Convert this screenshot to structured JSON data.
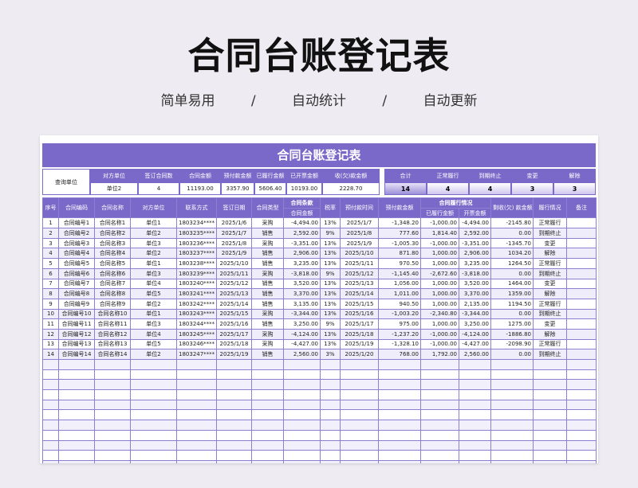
{
  "hero": {
    "title": "合同台账登记表",
    "tags": [
      "简单易用",
      "/",
      "自动统计",
      "/",
      "自动更新"
    ]
  },
  "sheet_title": "合同台账登记表",
  "summary": {
    "query_label": "查询单位",
    "headers": [
      "对方单位",
      "签订合同数",
      "合同金额",
      "预付款金额",
      "已履行金额",
      "已开票金额",
      "收(欠)款金额"
    ],
    "values": [
      "单位2",
      "4",
      "11193.00",
      "3357.90",
      "5606.40",
      "10193.00",
      "2228.70"
    ],
    "count_headers": [
      "合计",
      "正常履行",
      "到期终止",
      "变更",
      "解除"
    ],
    "counts": [
      "14",
      "4",
      "4",
      "3",
      "3"
    ]
  },
  "table": {
    "headers": {
      "seq": "序号",
      "code": "合同编码",
      "name": "合同名称",
      "party": "对方单位",
      "contact": "联系方式",
      "date": "签订日期",
      "type": "合同类型",
      "amount_top": "合同条款",
      "amount_bottom": "合同金额",
      "tax": "税率",
      "pre_time": "预付款时间",
      "pre_amt": "预付款金额",
      "perf_top": "合同履行情况",
      "perf_done": "已履行金额",
      "perf_inv": "开票金额",
      "recv": "剩收(欠) 款金额",
      "status": "履行情况",
      "remark": "备注"
    },
    "rows": [
      [
        "1",
        "合同编号1",
        "合同名称1",
        "单位1",
        "1803234****",
        "2025/1/6",
        "采购",
        "-4,494.00",
        "13%",
        "2025/1/7",
        "-1,348.20",
        "-1,000.00",
        "-4,494.00",
        "-2145.80",
        "正常履行",
        ""
      ],
      [
        "2",
        "合同编号2",
        "合同名称2",
        "单位2",
        "1803235****",
        "2025/1/7",
        "销售",
        "2,592.00",
        "9%",
        "2025/1/8",
        "777.60",
        "1,814.40",
        "2,592.00",
        "0.00",
        "到期终止",
        ""
      ],
      [
        "3",
        "合同编号3",
        "合同名称3",
        "单位3",
        "1803236****",
        "2025/1/8",
        "采购",
        "-3,351.00",
        "13%",
        "2025/1/9",
        "-1,005.30",
        "-1,000.00",
        "-3,351.00",
        "-1345.70",
        "变更",
        ""
      ],
      [
        "4",
        "合同编号4",
        "合同名称4",
        "单位2",
        "1803237****",
        "2025/1/9",
        "销售",
        "2,906.00",
        "13%",
        "2025/1/10",
        "871.80",
        "1,000.00",
        "2,906.00",
        "1034.20",
        "解除",
        ""
      ],
      [
        "5",
        "合同编号5",
        "合同名称5",
        "单位1",
        "1803238****",
        "2025/1/10",
        "销售",
        "3,235.00",
        "13%",
        "2025/1/11",
        "970.50",
        "1,000.00",
        "3,235.00",
        "1264.50",
        "正常履行",
        ""
      ],
      [
        "6",
        "合同编号6",
        "合同名称6",
        "单位3",
        "1803239****",
        "2025/1/11",
        "采购",
        "-3,818.00",
        "9%",
        "2025/1/12",
        "-1,145.40",
        "-2,672.60",
        "-3,818.00",
        "0.00",
        "到期终止",
        ""
      ],
      [
        "7",
        "合同编号7",
        "合同名称7",
        "单位4",
        "1803240****",
        "2025/1/12",
        "销售",
        "3,520.00",
        "13%",
        "2025/1/13",
        "1,056.00",
        "1,000.00",
        "3,520.00",
        "1464.00",
        "变更",
        ""
      ],
      [
        "8",
        "合同编号8",
        "合同名称8",
        "单位5",
        "1803241****",
        "2025/1/13",
        "销售",
        "3,370.00",
        "13%",
        "2025/1/14",
        "1,011.00",
        "1,000.00",
        "3,370.00",
        "1359.00",
        "解除",
        ""
      ],
      [
        "9",
        "合同编号9",
        "合同名称9",
        "单位2",
        "1803242****",
        "2025/1/14",
        "销售",
        "3,135.00",
        "13%",
        "2025/1/15",
        "940.50",
        "1,000.00",
        "2,135.00",
        "1194.50",
        "正常履行",
        ""
      ],
      [
        "10",
        "合同编号10",
        "合同名称10",
        "单位1",
        "1803243****",
        "2025/1/15",
        "采购",
        "-3,344.00",
        "13%",
        "2025/1/16",
        "-1,003.20",
        "-2,340.80",
        "-3,344.00",
        "0.00",
        "到期终止",
        ""
      ],
      [
        "11",
        "合同编号11",
        "合同名称11",
        "单位3",
        "1803244****",
        "2025/1/16",
        "销售",
        "3,250.00",
        "9%",
        "2025/1/17",
        "975.00",
        "1,000.00",
        "3,250.00",
        "1275.00",
        "变更",
        ""
      ],
      [
        "12",
        "合同编号12",
        "合同名称12",
        "单位4",
        "1803245****",
        "2025/1/17",
        "采购",
        "-4,124.00",
        "13%",
        "2025/1/18",
        "-1,237.20",
        "-1,000.00",
        "-4,124.00",
        "-1886.80",
        "解除",
        ""
      ],
      [
        "13",
        "合同编号13",
        "合同名称13",
        "单位5",
        "1803246****",
        "2025/1/18",
        "采购",
        "-4,427.00",
        "13%",
        "2025/1/19",
        "-1,328.10",
        "-1,000.00",
        "-4,427.00",
        "-2098.90",
        "正常履行",
        ""
      ],
      [
        "14",
        "合同编号14",
        "合同名称14",
        "单位2",
        "1803247****",
        "2025/1/19",
        "销售",
        "2,560.00",
        "3%",
        "2025/1/20",
        "768.00",
        "1,792.00",
        "2,560.00",
        "0.00",
        "到期终止",
        ""
      ]
    ]
  }
}
